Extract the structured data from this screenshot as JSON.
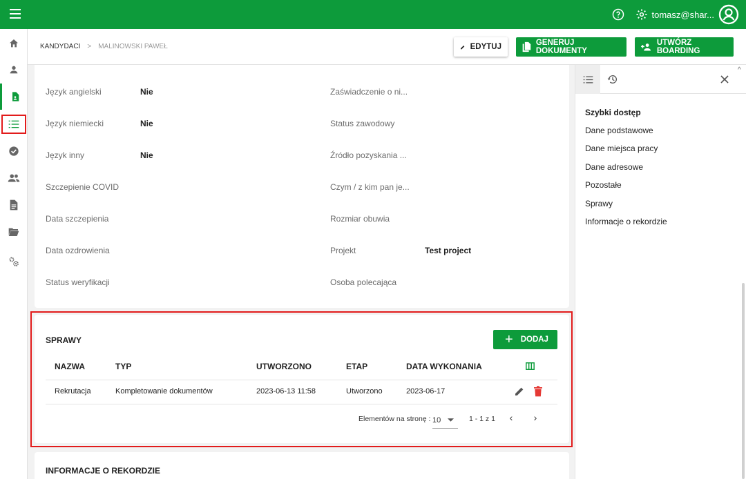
{
  "topbar": {
    "user_name": "tomasz@shar..."
  },
  "breadcrumb": {
    "root": "KANDYDACI",
    "separator": ">",
    "current": "MALINOWSKI PAWEŁ"
  },
  "actions": {
    "edit": "EDYTUJ",
    "generate": "GENERUJ DOKUMENTY",
    "boarding": "UTWÓRZ BOARDING"
  },
  "fields_left": [
    {
      "label": "Język angielski",
      "value": "Nie"
    },
    {
      "label": "Język niemiecki",
      "value": "Nie"
    },
    {
      "label": "Język inny",
      "value": "Nie"
    },
    {
      "label": "Szczepienie COVID",
      "value": ""
    },
    {
      "label": "Data szczepienia",
      "value": ""
    },
    {
      "label": "Data ozdrowienia",
      "value": ""
    },
    {
      "label": "Status weryfikacji",
      "value": ""
    }
  ],
  "fields_right": [
    {
      "label": "Zaświadczenie o ni...",
      "value": ""
    },
    {
      "label": "Status zawodowy",
      "value": ""
    },
    {
      "label": "Źródło pozyskania ...",
      "value": ""
    },
    {
      "label": "Czym / z kim pan je...",
      "value": ""
    },
    {
      "label": "Rozmiar obuwia",
      "value": ""
    },
    {
      "label": "Projekt",
      "value": "Test project"
    },
    {
      "label": "Osoba polecająca",
      "value": ""
    }
  ],
  "sprawy": {
    "title": "SPRAWY",
    "add_label": "DODAJ",
    "columns": [
      "NAZWA",
      "TYP",
      "UTWORZONO",
      "ETAP",
      "DATA WYKONANIA"
    ],
    "rows": [
      {
        "nazwa": "Rekrutacja",
        "typ": "Kompletowanie dokumentów",
        "utworzono": "2023-06-13 11:58",
        "etap": "Utworzono",
        "data_wykonania": "2023-06-17"
      }
    ],
    "pager": {
      "per_page_label": "Elementów na stronę :",
      "per_page_value": "10",
      "range": "1 - 1 z 1"
    }
  },
  "record_info": {
    "title": "INFORMACJE O REKORDZIE"
  },
  "quick_access": {
    "title": "Szybki dostęp",
    "items": [
      "Dane podstawowe",
      "Dane miejsca pracy",
      "Dane adresowe",
      "Pozostałe",
      "Sprawy",
      "Informacje o rekordzie"
    ]
  },
  "colors": {
    "brand": "#0d9b3b",
    "highlight": "#e21b1b",
    "delete": "#e53935"
  }
}
